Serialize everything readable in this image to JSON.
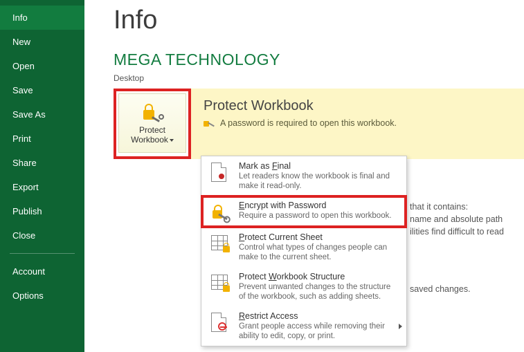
{
  "sidebar": {
    "items": [
      {
        "label": "Info",
        "active": true
      },
      {
        "label": "New"
      },
      {
        "label": "Open"
      },
      {
        "label": "Save"
      },
      {
        "label": "Save As"
      },
      {
        "label": "Print"
      },
      {
        "label": "Share"
      },
      {
        "label": "Export"
      },
      {
        "label": "Publish"
      },
      {
        "label": "Close"
      }
    ],
    "footer": [
      {
        "label": "Account"
      },
      {
        "label": "Options"
      }
    ]
  },
  "page": {
    "title": "Info",
    "doc_title": "MEGA TECHNOLOGY",
    "location": "Desktop"
  },
  "protect": {
    "button_line1": "Protect",
    "button_line2": "Workbook",
    "heading": "Protect Workbook",
    "status": "A password is required to open this workbook."
  },
  "menu": [
    {
      "title_pre": "Mark as ",
      "title_ul": "F",
      "title_post": "inal",
      "desc": "Let readers know the workbook is final and make it read-only."
    },
    {
      "title_pre": "",
      "title_ul": "E",
      "title_post": "ncrypt with Password",
      "desc": "Require a password to open this workbook.",
      "highlight": true
    },
    {
      "title_pre": "",
      "title_ul": "P",
      "title_post": "rotect Current Sheet",
      "desc": "Control what types of changes people can make to the current sheet."
    },
    {
      "title_pre": "Protect ",
      "title_ul": "W",
      "title_post": "orkbook Structure",
      "desc": "Prevent unwanted changes to the structure of the workbook, such as adding sheets."
    },
    {
      "title_pre": "",
      "title_ul": "R",
      "title_post": "estrict Access",
      "desc": "Grant people access while removing their ability to edit, copy, or print.",
      "submenu": true
    }
  ],
  "bg_text": {
    "l1": "that it contains:",
    "l2": "name and absolute path",
    "l3": "ilities find difficult to read",
    "l4": "saved changes."
  }
}
